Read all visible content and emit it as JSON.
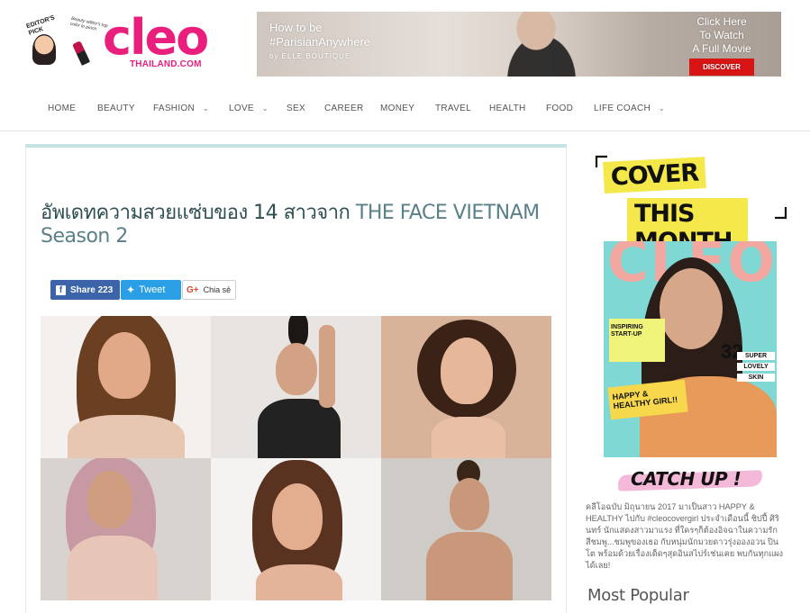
{
  "logo": {
    "word": "cleo",
    "domain": "THAILAND.COM",
    "editor_label": "EDITOR'S PICK",
    "note": "Beauty editor's top color to pinch"
  },
  "ad": {
    "line1": "How to be",
    "line2": "#ParisianAnywhere",
    "line3": "by ELLE BOUTIQUE",
    "cta1": "Click Here",
    "cta2": "To Watch",
    "cta3": "A Full Movie",
    "button": "DISCOVER"
  },
  "nav": {
    "items": [
      {
        "label": "HOME",
        "dropdown": false
      },
      {
        "label": "BEAUTY",
        "dropdown": false
      },
      {
        "label": "FASHION",
        "dropdown": true
      },
      {
        "label": "LOVE",
        "dropdown": true
      },
      {
        "label": "SEX",
        "dropdown": false
      },
      {
        "label": "CAREER",
        "dropdown": false
      },
      {
        "label": "MONEY",
        "dropdown": false
      },
      {
        "label": "TRAVEL",
        "dropdown": false
      },
      {
        "label": "HEALTH",
        "dropdown": false
      },
      {
        "label": "FOOD",
        "dropdown": false
      },
      {
        "label": "LIFE COACH",
        "dropdown": true
      }
    ]
  },
  "article": {
    "title_thai": "อัพเดทความสวยแซ่บของ 14 สาวจาก ",
    "title_en": "THE FACE VIETNAM Season 2"
  },
  "share": {
    "fb_label": "Share 223",
    "tw_label": "Tweet",
    "gp_label": "Chia sẻ"
  },
  "sidebar": {
    "cover_line1": "COVER",
    "cover_line2": "THIS MONTH",
    "mag_title": "CLEO",
    "mag_num": "32",
    "mag_badges": [
      "SUPER",
      "LOVELY",
      "SKIN"
    ],
    "mag_cover_text1": "INSPIRING START-UP",
    "mag_cover_text2": "HAPPY & HEALTHY GIRL!!",
    "catch_up": "CATCH UP !",
    "catch_up_text": "คลีโอฉบับ มิถุนายน 2017 มาเป็นสาว HAPPY & HEALTHY ไปกับ #cleocovergirl ประจำเดือนนี้ ชิปปี้ ศิรินทร์ นักแสดงสาวมาแรง ที่ใครๆก็ต้องอิจฉาในความรักสีชมพู...ชมพูของเธอ กับหนุ่มนักมวยดาวรุ่งอองอวน ปินโต พร้อมด้วยเรื่องเด็ดๆสุดอินสไปร์เช่นเคย พบกันทุกแผงได้เลย!",
    "most_popular": "Most Popular"
  },
  "colors": {
    "brand_pink": "#e91e7d",
    "title_teal": "#2f4f53",
    "facebook": "#3c64a8",
    "twitter": "#2b9fe6",
    "cover_yellow": "#f5e84a"
  }
}
